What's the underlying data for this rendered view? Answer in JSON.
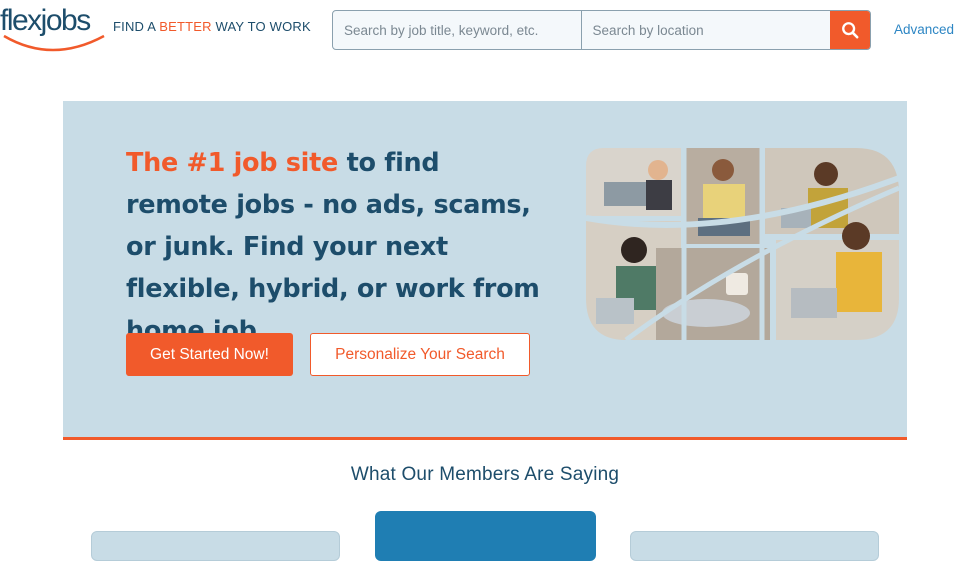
{
  "header": {
    "logo_text": "flexjobs",
    "tagline_pre": "FIND A ",
    "tagline_accent": "BETTER",
    "tagline_post": " WAY TO WORK",
    "search": {
      "keyword_placeholder": "Search by job title, keyword, etc.",
      "location_placeholder": "Search by location",
      "search_icon": "search-icon"
    },
    "advanced_link": "Advanced"
  },
  "hero": {
    "headline_accent": "The #1 job site",
    "headline_rest": " to find remote jobs - no ads, scams, or junk. Find your next flexible, hybrid, or work from home job.",
    "primary_button": "Get Started Now!",
    "secondary_button": "Personalize Your Search"
  },
  "testimonials": {
    "title": "What Our Members Are Saying"
  },
  "colors": {
    "brand_navy": "#1d4d6b",
    "accent_orange": "#f15a2b",
    "hero_bg": "#c8dce6",
    "link_blue": "#2d86c4"
  }
}
